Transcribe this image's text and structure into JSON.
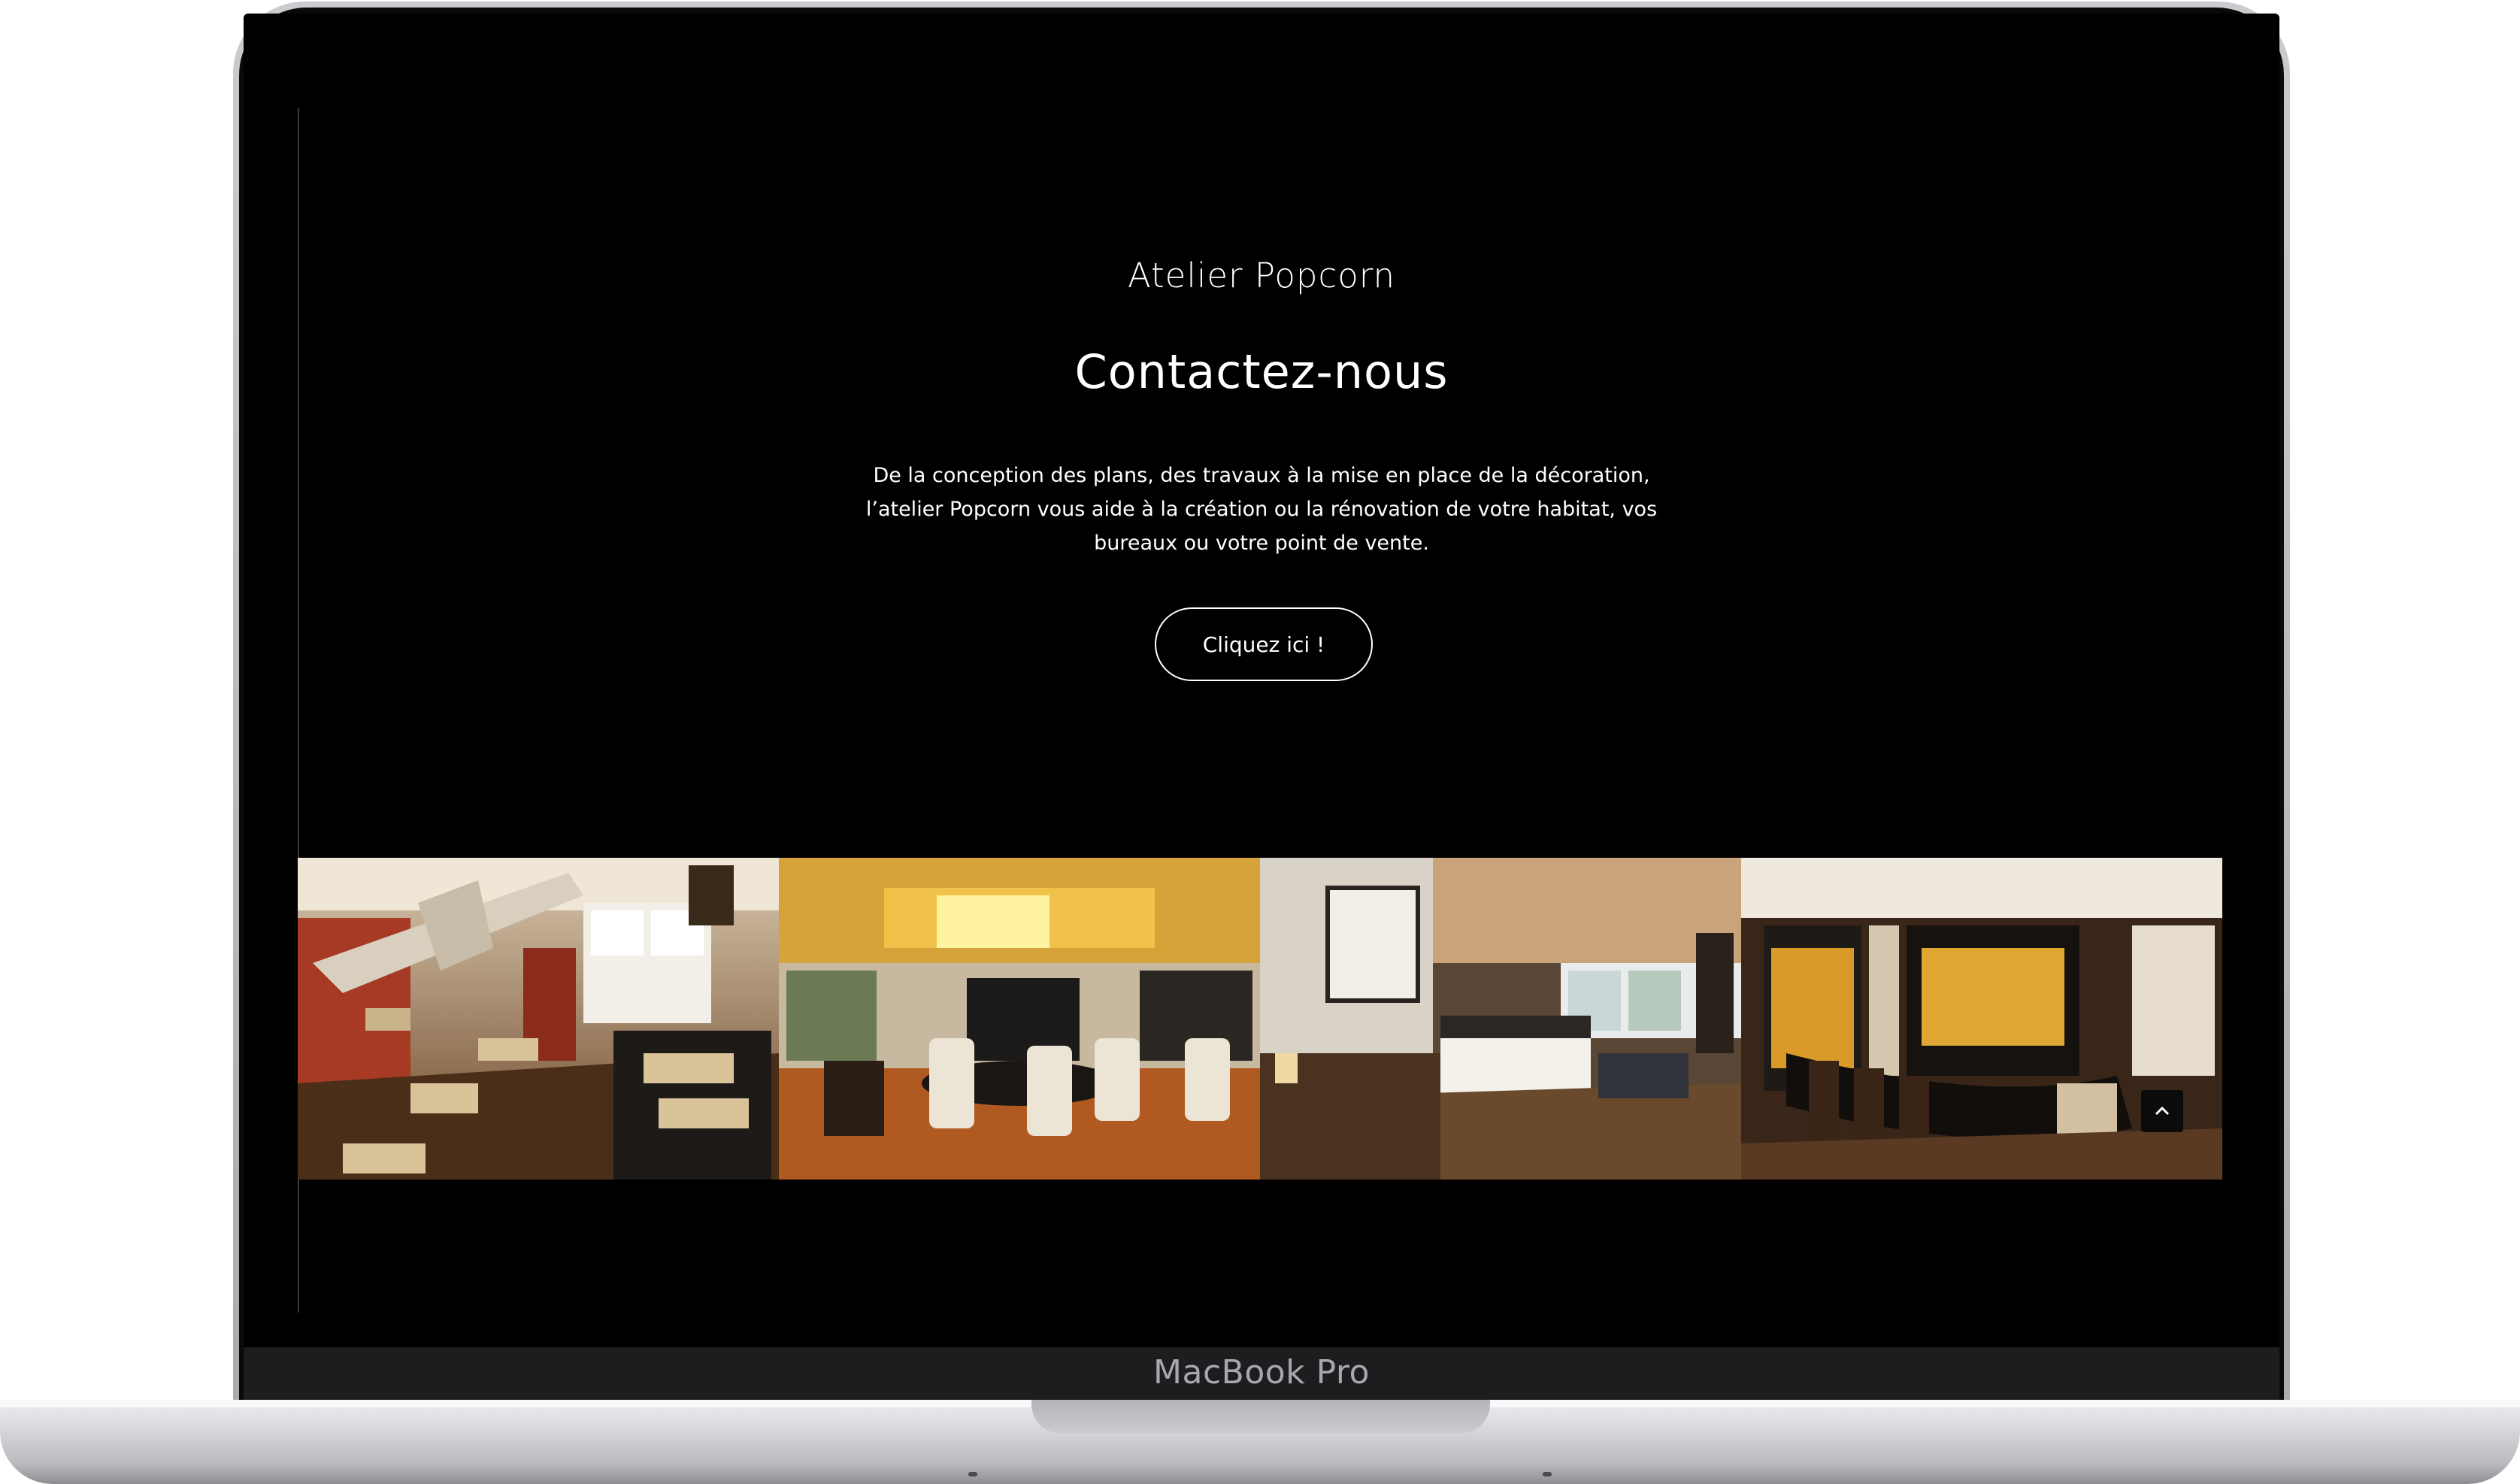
{
  "device": {
    "label": "MacBook Pro"
  },
  "site": {
    "brand": "Atelier Popcorn",
    "title": "Contactez-nous",
    "description": "De la conception des plans, des travaux à la mise en place de la décoration, l’atelier Popcorn vous aide à la création ou la rénovation de votre habitat, vos bureaux ou votre point de vente.",
    "cta_label": "Cliquez ici !"
  },
  "gallery": [
    {
      "subject": "restaurant dining room with vintage airplane"
    },
    {
      "subject": "dining room with yellow ceiling light"
    },
    {
      "subject": "chalet bedroom with wooden ceiling"
    },
    {
      "subject": "hotel bar with bottles and stools"
    }
  ],
  "icons": {
    "scroll_top": "chevron-up-icon"
  },
  "colors": {
    "background": "#000000",
    "text": "#ffffff"
  }
}
